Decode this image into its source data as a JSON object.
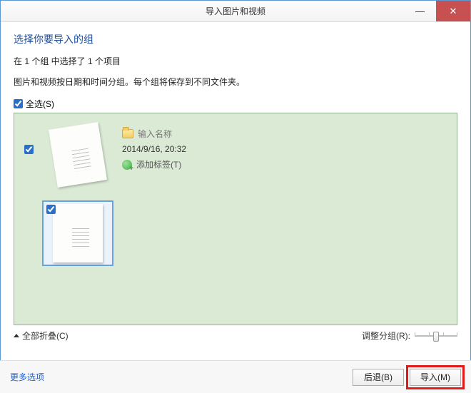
{
  "window": {
    "title": "导入图片和视频"
  },
  "heading": "选择你要导入的组",
  "summary": "在 1 个组 中选择了 1 个项目",
  "description": "图片和视频按日期和时间分组。每个组将保存到不同文件夹。",
  "select_all_label": "全选(S)",
  "group": {
    "name_placeholder": "输入名称",
    "datetime": "2014/9/16, 20:32",
    "add_tags_label": "添加标签(T)"
  },
  "collapse_all_label": "全部折叠(C)",
  "adjust_label": "调整分组(R):",
  "more_options_label": "更多选项",
  "buttons": {
    "back": "后退(B)",
    "import": "导入(M)"
  }
}
